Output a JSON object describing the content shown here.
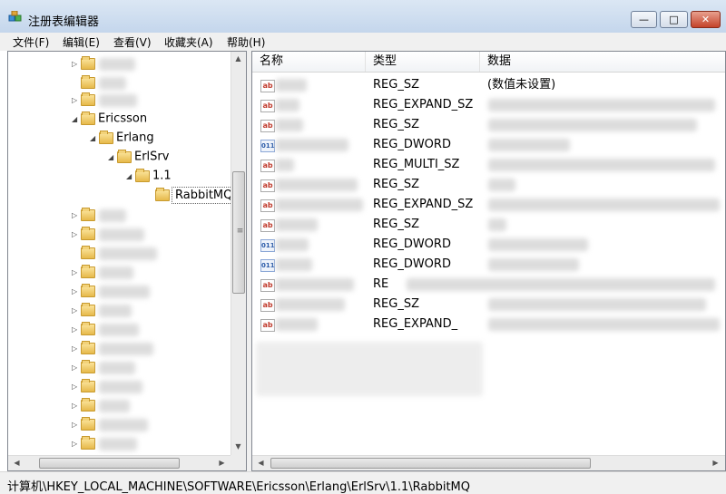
{
  "window": {
    "title": "注册表编辑器",
    "minimize": "—",
    "maximize": "□",
    "close": "✕"
  },
  "menu": [
    "文件(F)",
    "编辑(E)",
    "查看(V)",
    "收藏夹(A)",
    "帮助(H)"
  ],
  "tree": {
    "nodes": [
      {
        "label": "Ericsson",
        "expanded": true
      },
      {
        "label": "Erlang",
        "expanded": true
      },
      {
        "label": "ErlSrv",
        "expanded": true
      },
      {
        "label": "1.1",
        "expanded": true
      },
      {
        "label": "RabbitMQ",
        "selected": true
      }
    ]
  },
  "columns": [
    "名称",
    "类型",
    "数据"
  ],
  "values": [
    {
      "icon": "string-value-icon",
      "type": "REG_SZ",
      "data": "(数值未设置)"
    },
    {
      "icon": "string-value-icon",
      "type": "REG_EXPAND_SZ",
      "data": ""
    },
    {
      "icon": "string-value-icon",
      "type": "REG_SZ",
      "data": ""
    },
    {
      "icon": "binary-value-icon",
      "type": "REG_DWORD",
      "data": ""
    },
    {
      "icon": "string-value-icon",
      "type": "REG_MULTI_SZ",
      "data": ""
    },
    {
      "icon": "string-value-icon",
      "type": "REG_SZ",
      "data": ""
    },
    {
      "icon": "string-value-icon",
      "type": "REG_EXPAND_SZ",
      "data": ""
    },
    {
      "icon": "string-value-icon",
      "type": "REG_SZ",
      "data": ""
    },
    {
      "icon": "binary-value-icon",
      "type": "REG_DWORD",
      "data": ""
    },
    {
      "icon": "binary-value-icon",
      "type": "REG_DWORD",
      "data": ""
    },
    {
      "icon": "string-value-icon",
      "type": "RE",
      "data": ""
    },
    {
      "icon": "string-value-icon",
      "type": "REG_SZ",
      "data": ""
    },
    {
      "icon": "string-value-icon",
      "type": "REG_EXPAND_",
      "data": ""
    }
  ],
  "status": {
    "path": "计算机\\HKEY_LOCAL_MACHINE\\SOFTWARE\\Ericsson\\Erlang\\ErlSrv\\1.1\\RabbitMQ"
  },
  "icons": {
    "app": "registry-editor-icon",
    "folder": "folder-icon",
    "string": "ab",
    "binary": "011"
  },
  "colors": {
    "title_bg": "#c4d6ec",
    "close": "#c4432a",
    "folder": "#e6b94a"
  }
}
